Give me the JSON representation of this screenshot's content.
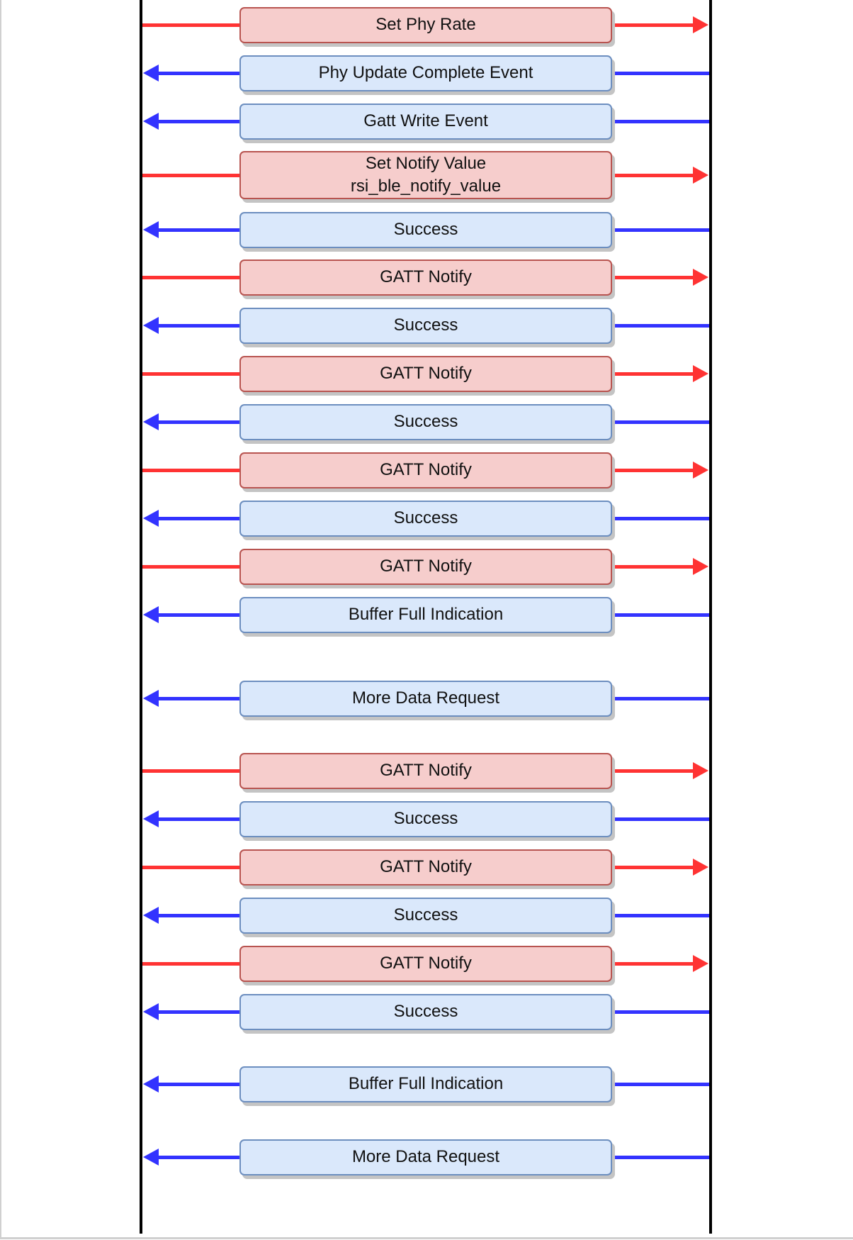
{
  "colors": {
    "request": "#ff3333",
    "response": "#3333ff",
    "request_box": "#f6cdcc",
    "response_box": "#dae8fb"
  },
  "messages": [
    {
      "direction": "right",
      "lines": [
        "Set Phy Rate"
      ]
    },
    {
      "direction": "left",
      "lines": [
        "Phy Update Complete Event"
      ]
    },
    {
      "direction": "left",
      "lines": [
        "Gatt Write Event"
      ]
    },
    {
      "direction": "right",
      "lines": [
        "Set Notify Value",
        "rsi_ble_notify_value"
      ]
    },
    {
      "direction": "left",
      "lines": [
        "Success"
      ]
    },
    {
      "direction": "right",
      "lines": [
        "GATT Notify"
      ]
    },
    {
      "direction": "left",
      "lines": [
        "Success"
      ]
    },
    {
      "direction": "right",
      "lines": [
        "GATT Notify"
      ]
    },
    {
      "direction": "left",
      "lines": [
        "Success"
      ]
    },
    {
      "direction": "right",
      "lines": [
        "GATT Notify"
      ]
    },
    {
      "direction": "left",
      "lines": [
        "Success"
      ]
    },
    {
      "direction": "right",
      "lines": [
        "GATT Notify"
      ]
    },
    {
      "direction": "left",
      "lines": [
        "Buffer Full Indication"
      ]
    },
    {
      "direction": "left",
      "lines": [
        "More Data Request"
      ]
    },
    {
      "direction": "right",
      "lines": [
        "GATT Notify"
      ]
    },
    {
      "direction": "left",
      "lines": [
        "Success"
      ]
    },
    {
      "direction": "right",
      "lines": [
        "GATT Notify"
      ]
    },
    {
      "direction": "left",
      "lines": [
        "Success"
      ]
    },
    {
      "direction": "right",
      "lines": [
        "GATT Notify"
      ]
    },
    {
      "direction": "left",
      "lines": [
        "Success"
      ]
    },
    {
      "direction": "left",
      "lines": [
        "Buffer Full Indication"
      ]
    },
    {
      "direction": "left",
      "lines": [
        "More Data Request"
      ]
    }
  ]
}
